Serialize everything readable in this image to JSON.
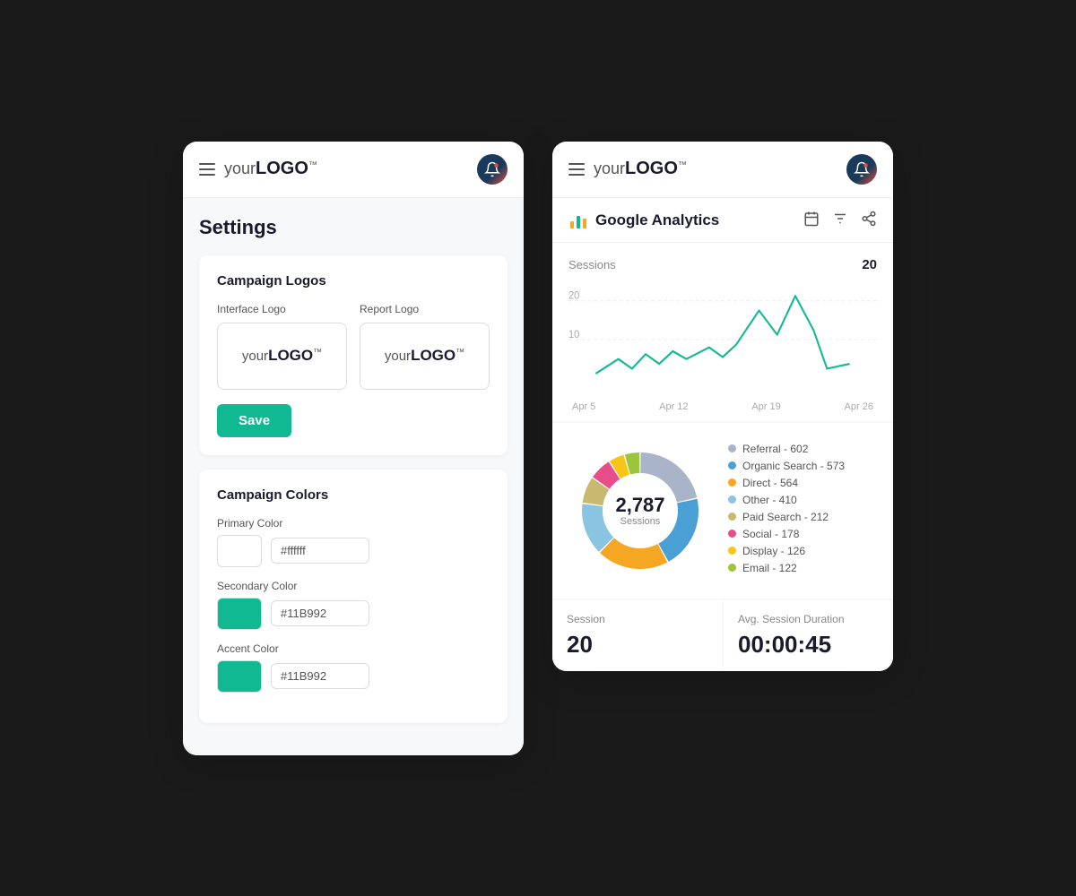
{
  "colors": {
    "primary": "#11B992",
    "accent": "#11B992",
    "dark": "#1a1a2e"
  },
  "shared": {
    "logo_prefix": "your",
    "logo_bold": "LOGO",
    "logo_tm": "™"
  },
  "left_panel": {
    "title": "Settings",
    "section_logos": {
      "title": "Campaign Logos",
      "interface_logo_label": "Interface Logo",
      "report_logo_label": "Report Logo"
    },
    "save_button": "Save",
    "section_colors": {
      "title": "Campaign Colors",
      "primary_label": "Primary Color",
      "primary_hex": "#ffffff",
      "secondary_label": "Secondary Color",
      "secondary_hex": "#11B992",
      "accent_label": "Accent Color",
      "accent_hex": "#11B992"
    }
  },
  "right_panel": {
    "analytics_title": "Google Analytics",
    "chart": {
      "label": "Sessions",
      "value": "20",
      "x_labels": [
        "Apr 5",
        "Apr 12",
        "Apr 19",
        "Apr 26"
      ],
      "y_labels": [
        "20",
        "10"
      ],
      "peak": 20
    },
    "donut": {
      "total": "2,787",
      "sublabel": "Sessions",
      "segments": [
        {
          "label": "Referral - 602",
          "color": "#aab4c8",
          "value": 602
        },
        {
          "label": "Organic Search - 573",
          "color": "#4a9fd5",
          "value": 573
        },
        {
          "label": "Direct - 564",
          "color": "#f5a623",
          "value": 564
        },
        {
          "label": "Other - 410",
          "color": "#89c4e1",
          "value": 410
        },
        {
          "label": "Paid Search - 212",
          "color": "#c8b96e",
          "value": 212
        },
        {
          "label": "Social - 178",
          "color": "#e84d8a",
          "value": 178
        },
        {
          "label": "Display - 126",
          "color": "#f5c518",
          "value": 126
        },
        {
          "label": "Email - 122",
          "color": "#9bc53d",
          "value": 122
        }
      ]
    },
    "stats": {
      "session_label": "Session",
      "session_value": "20",
      "avg_label": "Avg. Session Duration",
      "avg_value": "00:00:45"
    }
  }
}
